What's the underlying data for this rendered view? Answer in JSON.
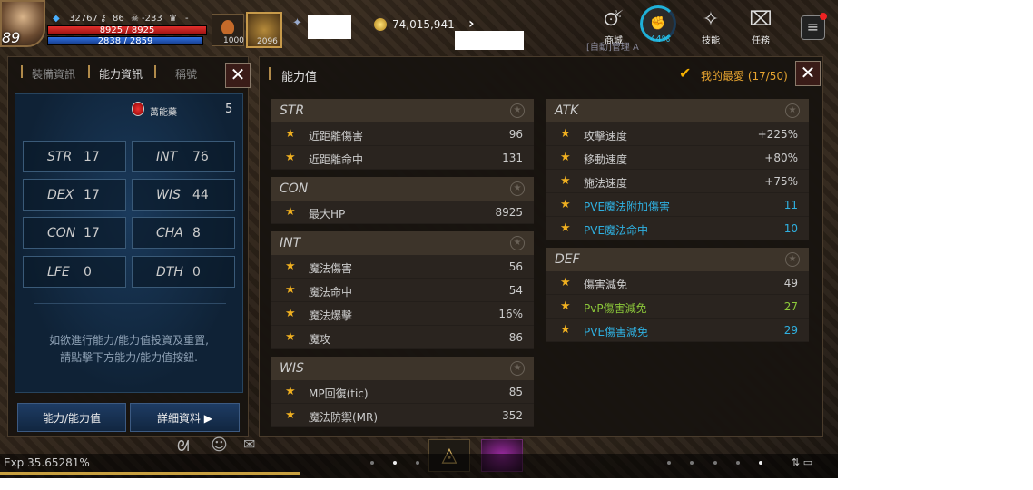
{
  "hud": {
    "level": "89",
    "gauge": "32767",
    "stat1": "86",
    "stat2": "-233",
    "stat3": "-",
    "hp": "8925 / 8925",
    "hp_fraction": 1.0,
    "mp": "2838 / 2859",
    "mp_fraction": 0.993,
    "potion_count": "1000",
    "pill_count": "2096",
    "gold": "74,015,941",
    "ring_percent": "44%",
    "shop_label": "商城",
    "skill_label": "技能",
    "quest_label": "任務",
    "auto_text": "[自動]管理 A"
  },
  "left_panel": {
    "tabs": [
      {
        "label": "裝備資訊"
      },
      {
        "label": "能力資訊"
      },
      {
        "label": "稱號"
      }
    ],
    "potion_label": "萬能藥",
    "potion_value": "5",
    "stats": [
      {
        "key": "STR",
        "value": "17"
      },
      {
        "key": "INT",
        "value": "76"
      },
      {
        "key": "DEX",
        "value": "17"
      },
      {
        "key": "WIS",
        "value": "44"
      },
      {
        "key": "CON",
        "value": "17"
      },
      {
        "key": "CHA",
        "value": "8"
      },
      {
        "key": "LFE",
        "value": "0"
      },
      {
        "key": "DTH",
        "value": "0"
      }
    ],
    "hint_line1": "如欲進行能力/能力值投資及重置,",
    "hint_line2": "請點擊下方能力/能力值按鈕.",
    "btn_ability": "能力/能力值",
    "btn_detail": "詳細資料"
  },
  "right_panel": {
    "title": "能力值",
    "favorite": "我的最愛 (17/50)",
    "groups_left": [
      {
        "title": "STR",
        "rows": [
          {
            "name": "近距離傷害",
            "value": "96"
          },
          {
            "name": "近距離命中",
            "value": "131"
          }
        ]
      },
      {
        "title": "CON",
        "rows": [
          {
            "name": "最大HP",
            "value": "8925"
          }
        ]
      },
      {
        "title": "INT",
        "rows": [
          {
            "name": "魔法傷害",
            "value": "56"
          },
          {
            "name": "魔法命中",
            "value": "54"
          },
          {
            "name": "魔法爆擊",
            "value": "16%"
          },
          {
            "name": "魔攻",
            "value": "86"
          }
        ]
      },
      {
        "title": "WIS",
        "rows": [
          {
            "name": "MP回復(tic)",
            "value": "85"
          },
          {
            "name": "魔法防禦(MR)",
            "value": "352"
          }
        ]
      }
    ],
    "groups_right": [
      {
        "title": "ATK",
        "rows": [
          {
            "name": "攻擊速度",
            "value": "+225%"
          },
          {
            "name": "移動速度",
            "value": "+80%"
          },
          {
            "name": "施法速度",
            "value": "+75%"
          },
          {
            "name": "PVE魔法附加傷害",
            "value": "11",
            "color": "blue"
          },
          {
            "name": "PVE魔法命中",
            "value": "10",
            "color": "blue"
          }
        ]
      },
      {
        "title": "DEF",
        "rows": [
          {
            "name": "傷害減免",
            "value": "49"
          },
          {
            "name": "PvP傷害減免",
            "value": "27",
            "color": "green"
          },
          {
            "name": "PVE傷害減免",
            "value": "29",
            "color": "blue"
          }
        ]
      }
    ]
  },
  "bottom": {
    "exp": "Exp 35.65281%"
  },
  "colors": {
    "accent": "#f0b020",
    "blue": "#2fb0e0",
    "green": "#8cc83a"
  }
}
